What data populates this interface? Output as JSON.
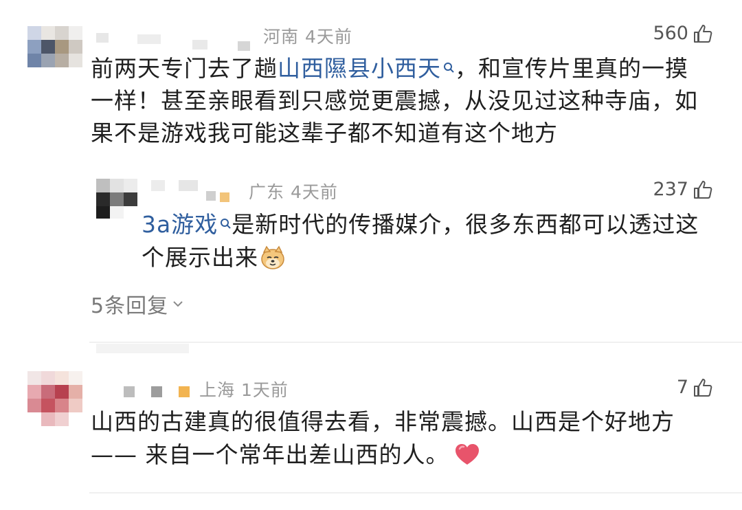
{
  "comments": [
    {
      "location": "河南",
      "time": "4天前",
      "likes": "560",
      "text": {
        "l1_pre": "前两天专门去了趟",
        "l1_link": "山西隰县小西天",
        "l1_post": "，和宣传片里真的一摸",
        "l2": "一样！甚至亲眼看到只感觉更震撼，从没见过这种寺庙，如",
        "l3": "果不是游戏我可能这辈子都不知道有这个地方"
      },
      "reply": {
        "location": "广东",
        "time": "4天前",
        "likes": "237",
        "l1_link": "3a游戏",
        "l1_post": "是新时代的传播媒介，很多东西都可以透过这",
        "l2": "个展示出来",
        "emoji": "doge-emoji"
      },
      "more_replies": "5条回复"
    },
    {
      "location": "上海",
      "time": "1天前",
      "likes": "7",
      "text": {
        "l1": "山西的古建真的很值得去看，非常震撼。山西是个好地方",
        "l2": "—— 来自一个常年出差山西的人。"
      },
      "emoji": "heart-emoji"
    }
  ],
  "colors": {
    "link": "#2f5e9e",
    "meta": "#9a9a9a",
    "text": "#1f1f1f"
  }
}
